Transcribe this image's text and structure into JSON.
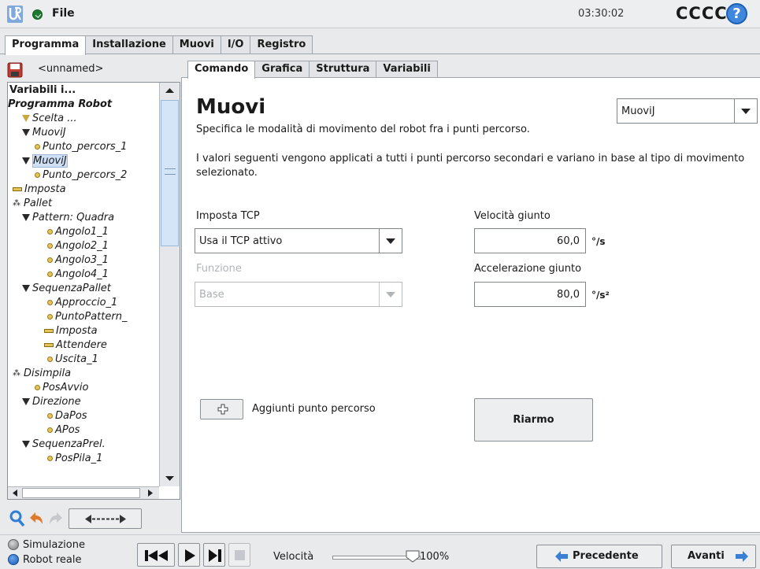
{
  "topbar": {
    "file_label": "File",
    "clock": "03:30:02",
    "robot_name": "CCCC",
    "help_glyph": "?"
  },
  "main_tabs": [
    "Programma",
    "Installazione",
    "Muovi",
    "I/O",
    "Registro"
  ],
  "program": {
    "name": "<unnamed>"
  },
  "tree": {
    "nodes": [
      {
        "label": "Variabili i...",
        "style": "bold-plain"
      },
      {
        "label": "Programma Robot",
        "style": "bold-italic"
      },
      {
        "label": "Scelta ..."
      },
      {
        "label": "MuoviJ"
      },
      {
        "label": "Punto_percors_1"
      },
      {
        "label": "MuoviJ",
        "selected": true
      },
      {
        "label": "Punto_percors_2"
      },
      {
        "label": "Imposta"
      },
      {
        "label": "Pallet"
      },
      {
        "label": "Pattern: Quadra"
      },
      {
        "label": "Angolo1_1"
      },
      {
        "label": "Angolo2_1"
      },
      {
        "label": "Angolo3_1"
      },
      {
        "label": "Angolo4_1"
      },
      {
        "label": "SequenzaPallet"
      },
      {
        "label": "Approccio_1"
      },
      {
        "label": "PuntoPattern_"
      },
      {
        "label": "Imposta"
      },
      {
        "label": "Attendere"
      },
      {
        "label": "Uscita_1"
      },
      {
        "label": "Disimpila"
      },
      {
        "label": "PosAvvio"
      },
      {
        "label": "Direzione"
      },
      {
        "label": "DaPos"
      },
      {
        "label": "APos"
      },
      {
        "label": "SequenzaPrel."
      },
      {
        "label": "PosPila_1"
      }
    ]
  },
  "sub_tabs": [
    "Comando",
    "Grafica",
    "Struttura",
    "Variabili"
  ],
  "move": {
    "title": "Muovi",
    "type_selected": "MuoviJ",
    "description": "Specifica le modalità di movimento del robot fra i punti percorso.",
    "info": "I valori seguenti vengono applicati a tutti i punti percorso secondari e variano in base al tipo di movimento selezionato.",
    "tcp_label": "Imposta TCP",
    "tcp_value": "Usa il TCP attivo",
    "feature_label": "Funzione",
    "feature_value": "Base",
    "joint_speed_label": "Velocità giunto",
    "joint_speed_value": "60,0",
    "joint_speed_unit": "°/s",
    "joint_accel_label": "Accelerazione giunto",
    "joint_accel_value": "80,0",
    "joint_accel_unit": "°/s²",
    "add_waypoint_label": "Aggiunti punto percorso",
    "rearm_label": "Riarmo"
  },
  "footer": {
    "simulation_label": "Simulazione",
    "real_robot_label": "Robot reale",
    "speed_label": "Velocità",
    "speed_value": "100%",
    "speed_fraction": 1.0,
    "prev_label": "Precedente",
    "next_label": "Avanti"
  },
  "colors": {
    "accent": "#3f86de",
    "status_green": "#1e7a2e",
    "selection": "#cfe0f6",
    "waypoint": "#e3c55a"
  }
}
